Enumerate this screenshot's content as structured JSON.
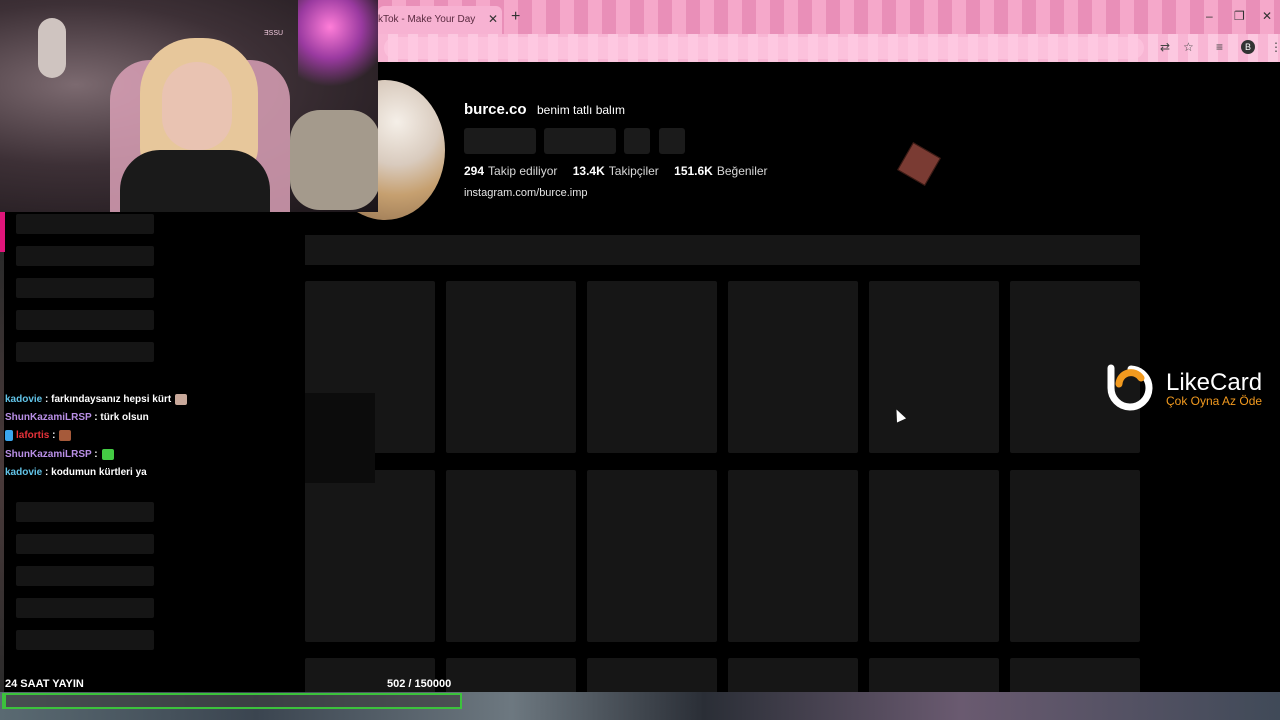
{
  "browser": {
    "tab_title": "kTok - Make Your Day",
    "tab_close": "✕",
    "new_tab": "+",
    "minimize": "–",
    "restore": "❐",
    "close": "✕",
    "translate_icon": "⇄",
    "bookmark_icon": "☆",
    "media_icon": "≡",
    "profile_initial": "B",
    "menu_icon": "⋮"
  },
  "webcam": {
    "sign_text": "ƎSSU"
  },
  "profile": {
    "username": "burce.co",
    "nickname": "benim tatlı balım",
    "stats": [
      {
        "value": "294",
        "label": "Takip ediliyor"
      },
      {
        "value": "13.4K",
        "label": "Takipçiler"
      },
      {
        "value": "151.6K",
        "label": "Beğeniler"
      }
    ],
    "bio_link": "instagram.com/burce.imp"
  },
  "chat": [
    {
      "user": "kadovie",
      "user_color": "#62c4e8",
      "message": ": farkındaysanız hepsi kürt",
      "emote_color": "#c8a89a"
    },
    {
      "user": "ShunKazamiLRSP",
      "user_color": "#b98fe6",
      "message": ": türk olsun",
      "emote_color": ""
    },
    {
      "user": "lafortis",
      "user_color": "#e8323a",
      "message": ":",
      "emote_color": "#a65a3a",
      "badge_color": "#3aa7f0"
    },
    {
      "user": "ShunKazamiLRSP",
      "user_color": "#b98fe6",
      "message": ":",
      "emote_color": "#44cc44"
    },
    {
      "user": "kadovie",
      "user_color": "#62c4e8",
      "message": ": kodumun kürtleri ya",
      "emote_color": ""
    }
  ],
  "sponsor": {
    "name": "LikeCard",
    "slogan": "Çok Oyna  Az Öde",
    "orange": "#f29a1f"
  },
  "goal": {
    "label": "24 SAAT YAYIN",
    "current": "502",
    "target": "/ 150000",
    "fraction": 0.00335
  }
}
